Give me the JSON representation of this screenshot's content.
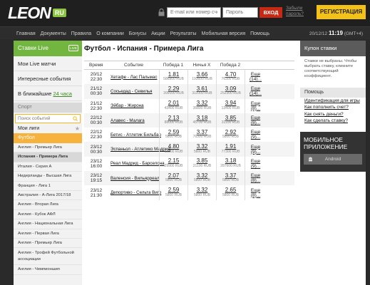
{
  "header": {
    "logo_text": "LEON",
    "logo_badge": "RU",
    "login_placeholder": "E-mail или номер счета",
    "password_placeholder": "Пароль",
    "login_button": "ВХОД",
    "forgot_link": "Забыли пароль?",
    "register_button": "РЕГИСТРАЦИЯ"
  },
  "nav": {
    "items": [
      "Главная",
      "Документы",
      "Правила",
      "О компании",
      "Бонусы",
      "Акции",
      "Результаты",
      "Мобильная версия",
      "Помощь"
    ],
    "date": "20/12/12",
    "time": "11:19",
    "timezone": "(GMT+4)"
  },
  "sidebar": {
    "live_title": "Ставки Live",
    "live_icon_label": "LIVE",
    "links": [
      "Мои Live матчи",
      "Интересные события"
    ],
    "soon_label": "В ближайшие",
    "soon_accent": "24 часа",
    "sport_header": "Спорт",
    "search_placeholder": "Поиск событий",
    "my_leagues": "Мои лиги",
    "sport": "Футбол",
    "leagues": [
      "Англия - Премьер Лига",
      "Испания - Примера Лига",
      "Италия - Серия А",
      "Нидерланды - Высшая Лига",
      "Франция - Лига 1",
      "Австралия - А-Лига 2017/18",
      "Англия - Вторая Лига",
      "Англия - Кубок АФЛ",
      "Англия - Национальная Лига",
      "Англия - Первая Лига",
      "Англия - Премьер Лига",
      "Англия - Трофей Футбольной ассоциации",
      "Англия - Чемпионшип"
    ]
  },
  "main": {
    "title": "Футбол - Испания - Примера Лига",
    "columns": [
      "Время",
      "Событие",
      "Победа 1",
      "Ничья X",
      "Победа 2"
    ],
    "more_label": "Еще",
    "rows": [
      {
        "date": "20/12",
        "time": "22:30",
        "event": "Хетафе - Лас Пальмас",
        "o1": "1.81",
        "m1": "586900 RUB",
        "ox": "3.66",
        "mx": "193600 RUB",
        "o2": "4.70",
        "m2": "76300 RUB",
        "more": "(14)..."
      },
      {
        "date": "21/12",
        "time": "00:30",
        "event": "Сосьедад - Севилья",
        "o1": "2.29",
        "m1": "399100 RUB",
        "ox": "3.61",
        "mx": "311000 RUB",
        "o2": "3.09",
        "m2": "252300 RUB",
        "more": "(14)..."
      },
      {
        "date": "21/12",
        "time": "22:30",
        "event": "Эйбар - Жирона",
        "o1": "2.01",
        "m1": "43400 RUB",
        "ox": "3.32",
        "mx": "35800 RUB",
        "o2": "3.94",
        "m2": "13400 RUB",
        "more": "(8)..."
      },
      {
        "date": "22/12",
        "time": "00:30",
        "event": "Алавес - Малага",
        "o1": "2.13",
        "m1": "88000 RUB",
        "ox": "3.18",
        "mx": "45700 RUB",
        "o2": "3.85",
        "m2": "31100 RUB",
        "more": "(8)..."
      },
      {
        "date": "22/12",
        "time": "22:30",
        "event": "Бетис - Атлетик Бильбао",
        "o1": "2.59",
        "m1": "5800 RUB",
        "ox": "3.37",
        "mx": "76300 RUB",
        "o2": "2.92",
        "m2": "5800 RUB",
        "more": "(9)..."
      },
      {
        "date": "23/12",
        "time": "00:30",
        "event": "Эспаньол - Атлетико Мадрид",
        "o1": "4.80",
        "m1": "12300 RUB",
        "ox": "3.32",
        "mx": "5800 RUB",
        "o2": "1.91",
        "m2": "77300 RUB",
        "more": "(9)..."
      },
      {
        "date": "23/12",
        "time": "16:00",
        "event": "Реал Мадрид - Барселона",
        "o1": "2.15",
        "m1": "29900 RUB",
        "ox": "3.85",
        "mx": "21100 RUB",
        "o2": "3.18",
        "m2": "287600 RUB",
        "more": "(9)..."
      },
      {
        "date": "23/12",
        "time": "19:15",
        "event": "Валенсия - Вильярреал",
        "o1": "2.07",
        "m1": "5800 RUB",
        "ox": "3.32",
        "mx": "5800 RUB",
        "o2": "3.37",
        "m2": "5800 RUB",
        "more": "(8)..."
      },
      {
        "date": "23/12",
        "time": "21:30",
        "event": "Депортиво - Сельта Виго",
        "o1": "2.59",
        "m1": "5800 RUB",
        "ox": "3.32",
        "mx": "5800 RUB",
        "o2": "2.65",
        "m2": "5800 RUB",
        "more": "(8)..."
      }
    ]
  },
  "coupon": {
    "title": "Купон ставки",
    "text": "Ставки не выбраны. Чтобы выбрать ставку, кликните соответствующий коэффициент."
  },
  "help": {
    "title": "Помощь",
    "links": [
      "Идентификация для игры",
      "Как пополнить счет?",
      "Как снять деньги?",
      "Как сделать ставку?"
    ]
  },
  "mobile": {
    "title": "МОБИЛЬНОЕ ПРИЛОЖЕНИЕ",
    "android_label": "Android"
  },
  "colors": {
    "accent_green": "#72b640",
    "login_red": "#c62a14",
    "register_yellow": "#f4c217",
    "active_sport_orange": "#f6b23c"
  }
}
